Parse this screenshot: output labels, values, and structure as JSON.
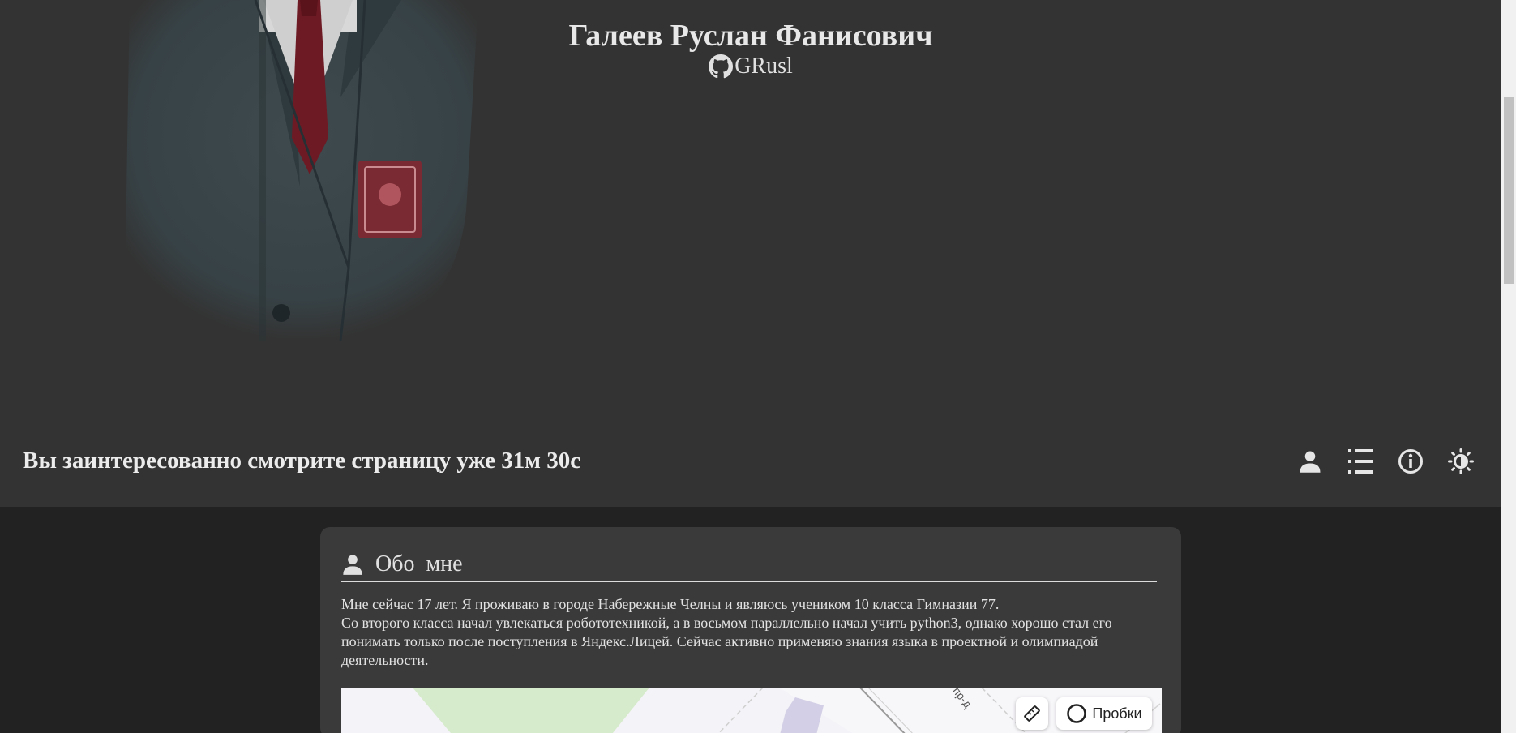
{
  "profile": {
    "name": "Галеев Руслан Фанисович",
    "github_username": "GRusl"
  },
  "timer": {
    "text": "Вы заинтересованно смотрите страницу уже 31м 30с"
  },
  "toolbar": {
    "icons": [
      "user-icon",
      "list-icon",
      "info-icon",
      "theme-icon"
    ]
  },
  "about": {
    "title": "Обо  мне",
    "paragraph1": "Мне сейчас 17 лет. Я проживаю в городе Набережные Челны и являюсь учеником 10 класса Гимназии 77.",
    "paragraph2": "Со второго класса начал увлекаться робототехникой, а в восьмом параллельно начал учить python3, однако хорошо стал его понимать только после поступления в Яндекс.Лицей. Сейчас активно применяю знания языка в проектной и олимпиадой деятельности."
  },
  "map": {
    "street_label": "пр-д",
    "traffic_label": "Пробки"
  },
  "colors": {
    "header_bg": "#333333",
    "page_bg": "#222222",
    "card_bg": "#3a3a3a",
    "text": "#e6e6e6"
  }
}
